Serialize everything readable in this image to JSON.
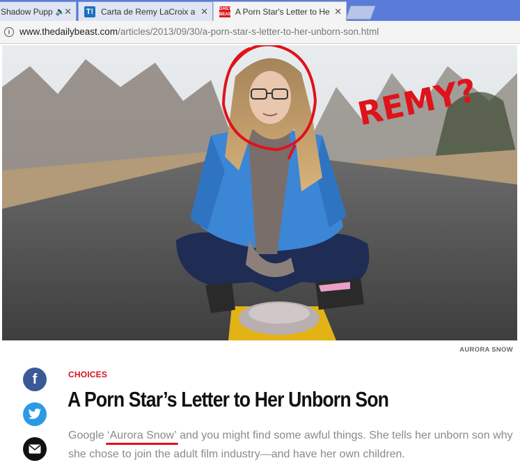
{
  "browser": {
    "tabs": [
      {
        "title": "Shadow Pupp",
        "favicon": "none",
        "audio_icon": "speaker-icon"
      },
      {
        "title": "Carta de Remy LaCroix a",
        "favicon": "T!"
      },
      {
        "title": "A Porn Star's Letter to He",
        "favicon": "daily-beast-icon",
        "active": true
      }
    ],
    "url_domain": "www.thedailybeast.com",
    "url_path": "/articles/2013/09/30/a-porn-star-s-letter-to-her-unborn-son.html"
  },
  "hero": {
    "annotation_text": "REMY?",
    "photo_credit": "AURORA SNOW"
  },
  "article": {
    "kicker": "CHOICES",
    "headline": "A Porn Star’s Letter to Her Unborn Son",
    "dek_before": "Google ",
    "dek_highlight": "‘Aurora Snow’",
    "dek_after": " and you might find some awful things. She tells her unborn son why she chose to join the adult film industry—and have her own children."
  },
  "social": {
    "facebook_glyph": "f"
  },
  "colors": {
    "tabstrip": "#5a7bd8",
    "kicker_red": "#d4151d",
    "annotation_red": "#e0121a",
    "facebook": "#3b5998",
    "twitter": "#2b9ae6"
  }
}
